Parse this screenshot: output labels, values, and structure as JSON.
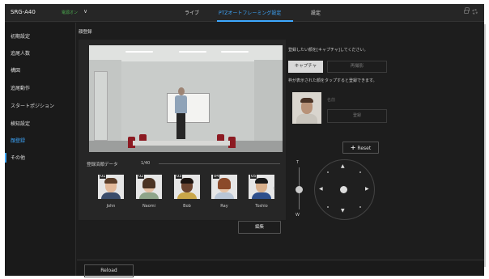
{
  "header": {
    "model": "SRG-A40",
    "power": "電源オン",
    "chevron_icon": "chevron-down",
    "tabs": [
      "ライブ",
      "PTZオートフレーミング設定",
      "設定"
    ],
    "active_tab": 1,
    "accent": "#3ea8ff",
    "power_color": "#4caf50"
  },
  "sidebar": {
    "items": [
      "初期設定",
      "追尾人数",
      "構図",
      "追尾動作",
      "スタートポジション",
      "検知設定",
      "顔登録",
      "その他"
    ],
    "active_index": 6
  },
  "main": {
    "page_title": "顔登録",
    "registered_label": "登録済顔データ",
    "registered_count": "1/40",
    "faces": [
      {
        "num": "01",
        "name": "John"
      },
      {
        "num": "02",
        "name": "Naomi"
      },
      {
        "num": "03",
        "name": "Bob"
      },
      {
        "num": "04",
        "name": "Ray"
      },
      {
        "num": "05",
        "name": "Toshio"
      }
    ],
    "more_icon": "chevron-right",
    "edit_button": "編集"
  },
  "capture_panel": {
    "instruction": "登録したい顔を[キャプチャ]してください。",
    "capture_button": "キャプチャ",
    "retake_button": "再撮影",
    "tap_hint": "枠が表示された顔をタップすると登録できます。",
    "name_placeholder": "名前",
    "register_button": "登録"
  },
  "ptz": {
    "reset_button": "Reset",
    "zoom_tele": "T",
    "zoom_wide": "W"
  },
  "footer": {
    "reload_button": "Reload"
  }
}
